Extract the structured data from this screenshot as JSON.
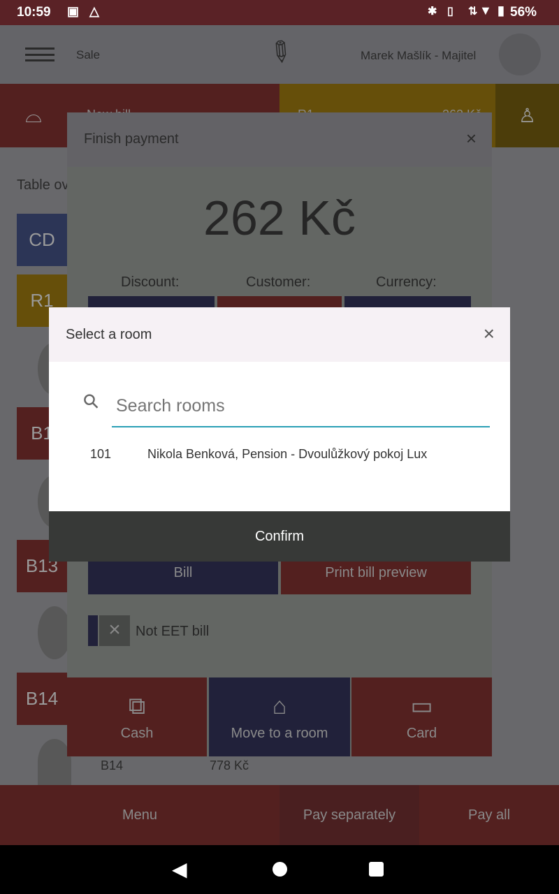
{
  "status_bar": {
    "time": "10:59",
    "battery": "56%"
  },
  "header": {
    "section": "Sale",
    "user": "Marek Mašlík - Majitel"
  },
  "top_tiles": {
    "new_bill": "New bill",
    "r1": "R1",
    "r1_amount": "262 Kč"
  },
  "sidebar": {
    "title": "Table overview",
    "tables": [
      "CD",
      "R1",
      "B1",
      "B13",
      "B14"
    ],
    "row": {
      "name": "B14",
      "amount": "778 Kč"
    }
  },
  "finish_payment": {
    "title": "Finish payment",
    "amount": "262 Kč",
    "discount_label": "Discount:",
    "customer_label": "Customer:",
    "currency_label": "Currency:",
    "bill": "Bill",
    "print_preview": "Print bill preview",
    "not_eet": "Not EET bill",
    "cash": "Cash",
    "move_to_room": "Move to a room",
    "card": "Card"
  },
  "bottom_bar": {
    "menu": "Menu",
    "pay_separately": "Pay separately",
    "pay_all": "Pay all"
  },
  "room_dialog": {
    "title": "Select a room",
    "search_placeholder": "Search rooms",
    "search_value": "",
    "rooms": [
      {
        "number": "101",
        "description": "Nikola Benková, Pension - Dvoulůžkový pokoj Lux"
      }
    ],
    "confirm": "Confirm"
  },
  "colors": {
    "accent": "#2a9fb5",
    "confirm_bg": "#373937",
    "status_bar": "#5a2226"
  }
}
